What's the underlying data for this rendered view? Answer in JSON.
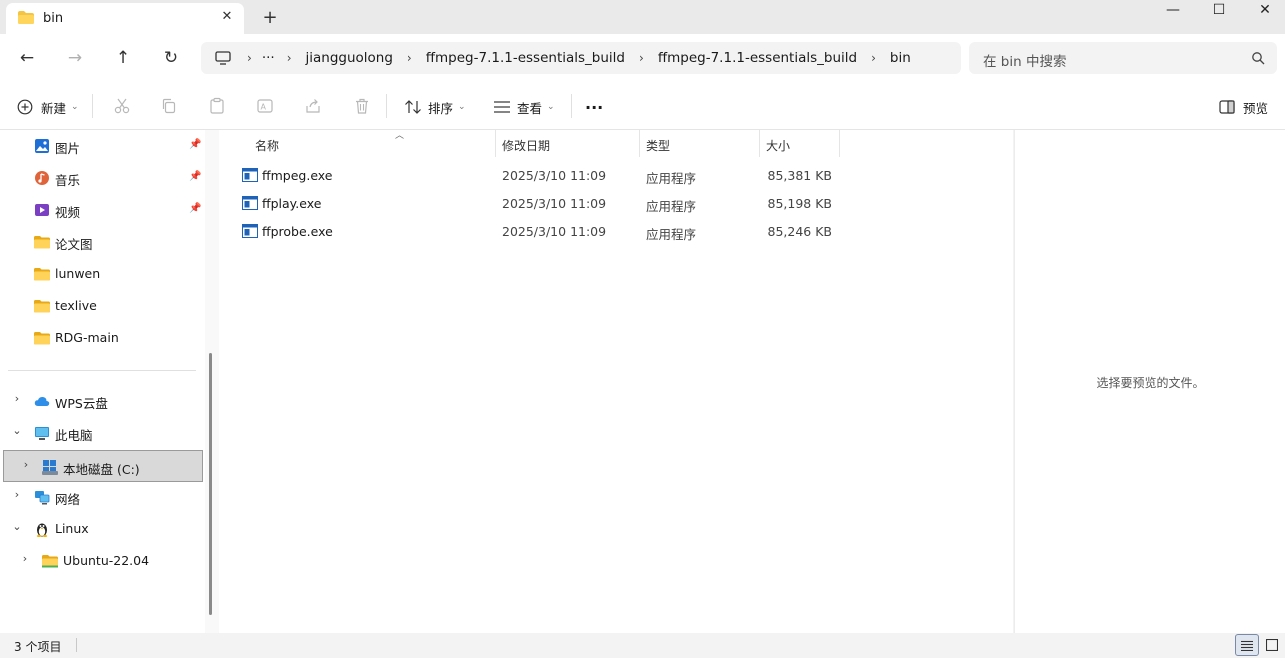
{
  "window": {
    "tab_title": "bin",
    "tab_close": "✕",
    "new_tab": "+",
    "minimize": "—",
    "maximize": "☐",
    "close": "✕"
  },
  "navbar": {
    "back": "←",
    "forward": "→",
    "up": "↑",
    "refresh": "↻",
    "more_crumbs": "···",
    "breadcrumbs": [
      "jiangguolong",
      "ffmpeg-7.1.1-essentials_build",
      "ffmpeg-7.1.1-essentials_build",
      "bin"
    ],
    "search_placeholder": "在 bin 中搜索"
  },
  "toolbar": {
    "new_label": "新建",
    "sort_label": "排序",
    "view_label": "查看",
    "more": "···",
    "preview_label": "预览"
  },
  "nav_pane": {
    "quick": [
      {
        "label": "图片",
        "icon": "pictures-icon",
        "pinned": true
      },
      {
        "label": "音乐",
        "icon": "music-icon",
        "pinned": true
      },
      {
        "label": "视频",
        "icon": "video-icon",
        "pinned": true
      },
      {
        "label": "论文图",
        "icon": "folder-icon",
        "pinned": false
      },
      {
        "label": "lunwen",
        "icon": "folder-icon",
        "pinned": false
      },
      {
        "label": "texlive",
        "icon": "folder-icon",
        "pinned": false
      },
      {
        "label": "RDG-main",
        "icon": "folder-icon",
        "pinned": false
      }
    ],
    "wps": "WPS云盘",
    "this_pc": "此电脑",
    "local_disk": "本地磁盘 (C:)",
    "network": "网络",
    "linux": "Linux",
    "ubuntu": "Ubuntu-22.04"
  },
  "file_list": {
    "columns": {
      "name": "名称",
      "date": "修改日期",
      "type": "类型",
      "size": "大小"
    },
    "files": [
      {
        "name": "ffmpeg.exe",
        "date": "2025/3/10 11:09",
        "type": "应用程序",
        "size": "85,381 KB"
      },
      {
        "name": "ffplay.exe",
        "date": "2025/3/10 11:09",
        "type": "应用程序",
        "size": "85,198 KB"
      },
      {
        "name": "ffprobe.exe",
        "date": "2025/3/10 11:09",
        "type": "应用程序",
        "size": "85,246 KB"
      }
    ]
  },
  "preview": {
    "message": "选择要预览的文件。"
  },
  "status": {
    "item_count": "3 个项目"
  },
  "colors": {
    "folder": "#f4c542",
    "accent": "#0067c0",
    "exe_blue": "#1f63b8"
  }
}
